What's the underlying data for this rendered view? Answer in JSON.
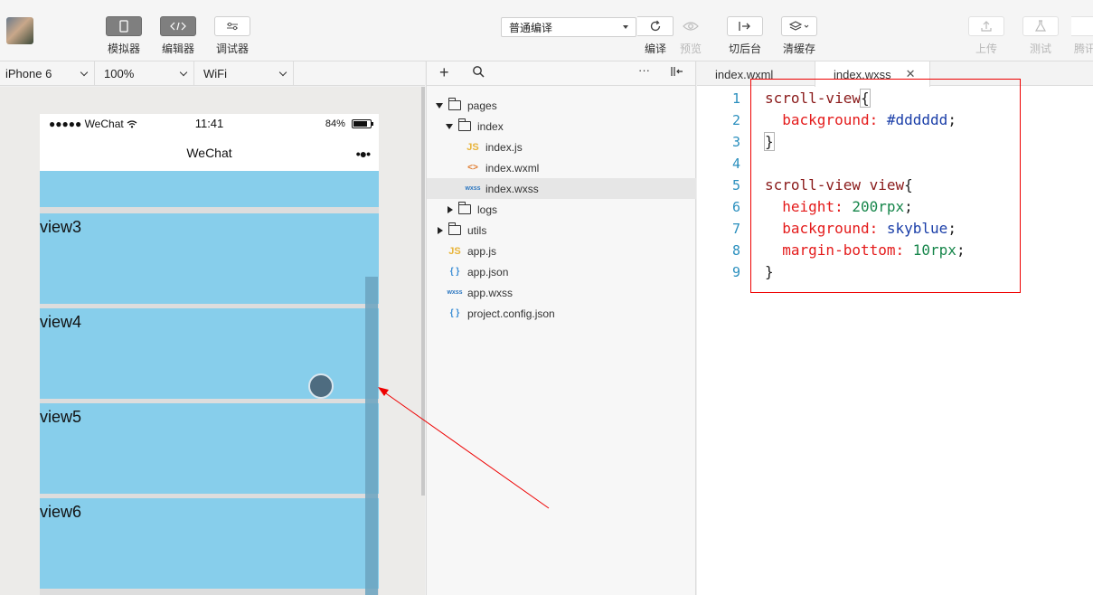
{
  "toolbar": {
    "buttons": [
      {
        "label": "模拟器",
        "icon": "phone-icon"
      },
      {
        "label": "编辑器",
        "icon": "code-icon"
      },
      {
        "label": "调试器",
        "icon": "sliders-icon"
      }
    ],
    "compile_mode": "普通编译",
    "actions": [
      {
        "label": "编译",
        "icon": "refresh-icon",
        "enabled": true
      },
      {
        "label": "预览",
        "icon": "eye-icon",
        "enabled": false
      },
      {
        "label": "切后台",
        "icon": "switch-icon",
        "enabled": true
      },
      {
        "label": "清缓存",
        "icon": "layers-icon",
        "enabled": true
      },
      {
        "label": "上传",
        "icon": "upload-icon",
        "enabled": false
      },
      {
        "label": "测试",
        "icon": "flask-icon",
        "enabled": false
      },
      {
        "label": "腾讯",
        "icon": "cloud-icon",
        "enabled": false
      }
    ]
  },
  "devicebar": {
    "device": "iPhone 6",
    "zoom": "100%",
    "network": "WiFi"
  },
  "phone": {
    "carrier": "●●●●● WeChat",
    "time": "11:41",
    "battery": "84%",
    "battery_level": 0.84,
    "nav_title": "WeChat",
    "nav_more": "•●•",
    "views": [
      "view3",
      "view4",
      "view5",
      "view6"
    ]
  },
  "filetree": {
    "nodes": [
      {
        "name": "pages",
        "type": "folder",
        "open": true
      },
      {
        "name": "index",
        "type": "folder",
        "open": true
      },
      {
        "name": "index.js",
        "type": "js",
        "icon_text": "JS"
      },
      {
        "name": "index.wxml",
        "type": "wxml",
        "icon_text": "<>"
      },
      {
        "name": "index.wxss",
        "type": "wxss",
        "icon_text": "wxss"
      },
      {
        "name": "logs",
        "type": "folder",
        "open": false
      },
      {
        "name": "utils",
        "type": "folder",
        "open": false
      },
      {
        "name": "app.js",
        "type": "js",
        "icon_text": "JS"
      },
      {
        "name": "app.json",
        "type": "json",
        "icon_text": "{ }"
      },
      {
        "name": "app.wxss",
        "type": "wxss",
        "icon_text": "wxss"
      },
      {
        "name": "project.config.json",
        "type": "json",
        "icon_text": "{ }"
      }
    ]
  },
  "editor": {
    "tabs": [
      "index.wxml",
      "index.wxss"
    ],
    "active_tab": "index.wxss",
    "line_numbers": [
      "1",
      "2",
      "3",
      "4",
      "5",
      "6",
      "7",
      "8",
      "9"
    ],
    "code": {
      "l1_sel": "scroll-view",
      "l1_brace": "{",
      "l2_prop": "background:",
      "l2_val": "#dddddd",
      "l3_brace": "}",
      "l5_sel": "scroll-view view",
      "l5_brace": "{",
      "l6_prop": "height:",
      "l6_val": "200rpx",
      "l7_prop": "background:",
      "l7_val": "skyblue",
      "l8_prop": "margin-bottom:",
      "l8_val": "10rpx",
      "l9_brace": "}",
      "semicolon": ";"
    }
  },
  "colors": {
    "view_bg": "#87ceeb",
    "scroll_bg": "#dddddd",
    "annotation": "#ee0000"
  }
}
